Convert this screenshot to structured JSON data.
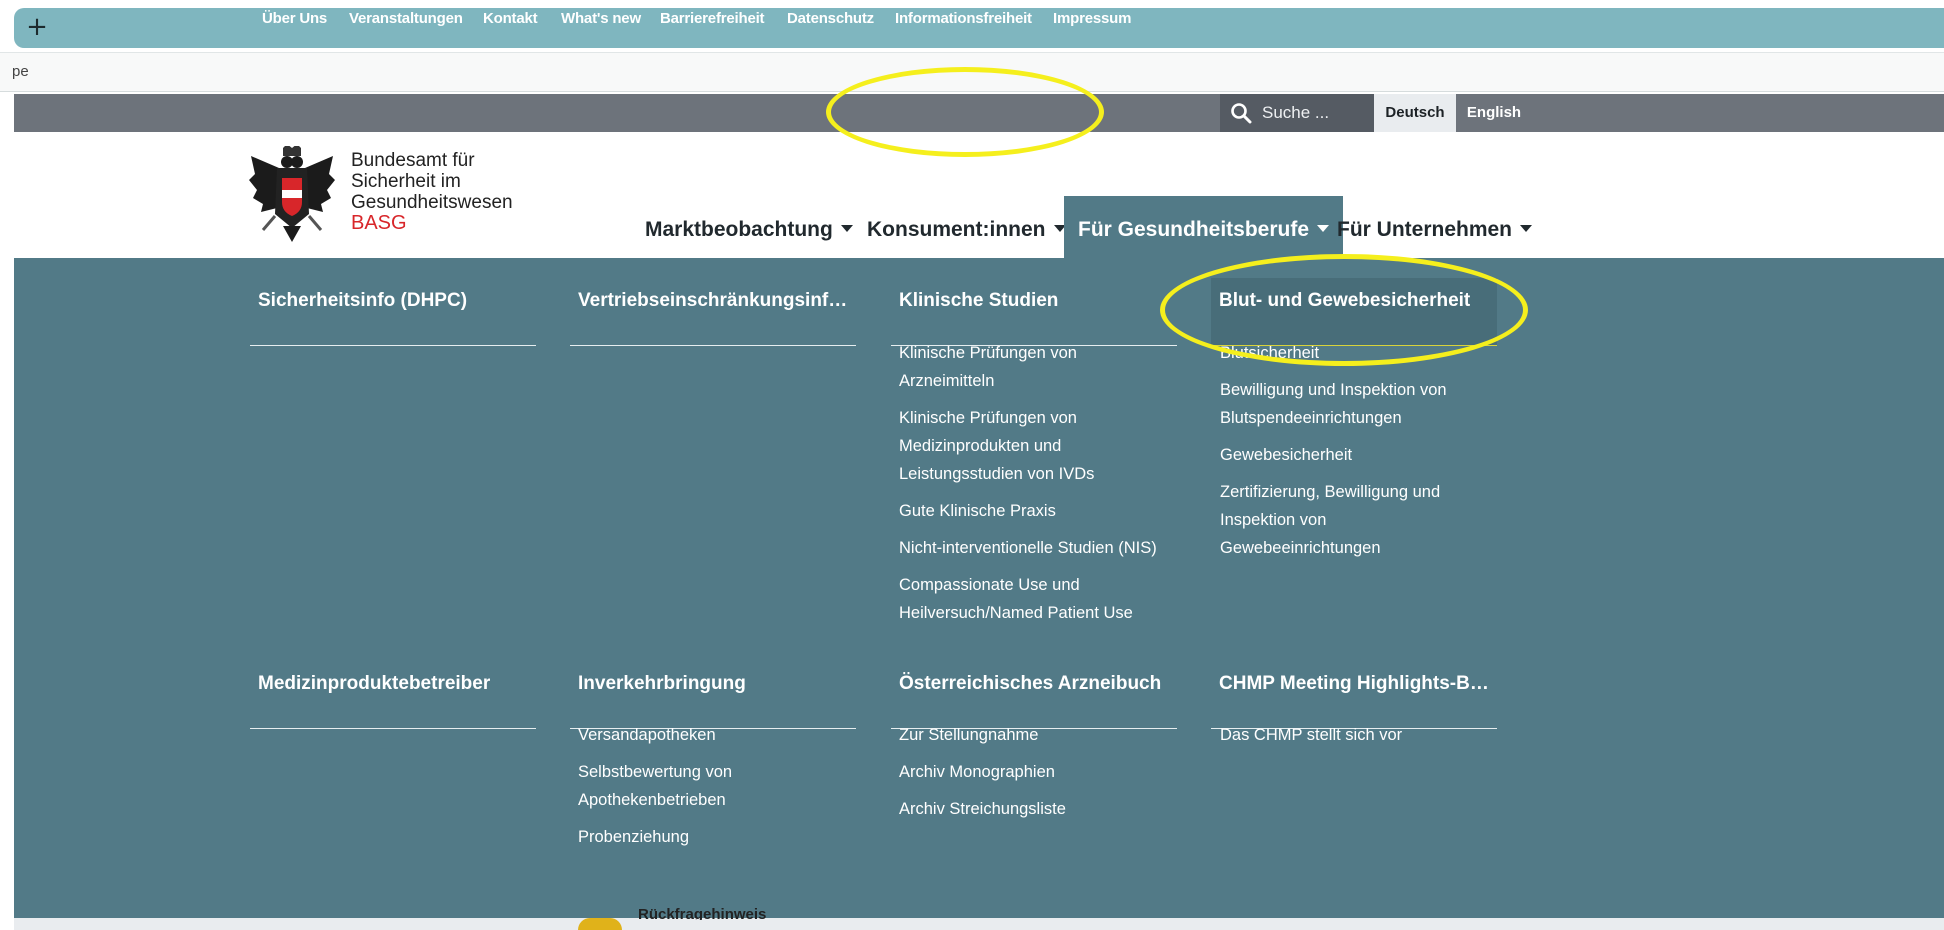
{
  "browser": {
    "new_tab_label": "+",
    "address_fragment": "pe"
  },
  "topbar": {
    "links": [
      "Über Uns",
      "Veranstaltungen",
      "Kontakt",
      "What's new",
      "Barrierefreiheit",
      "Datenschutz",
      "Informationsfreiheit",
      "Impressum"
    ],
    "search_placeholder": "Suche ...",
    "languages": [
      "Deutsch",
      "English"
    ],
    "active_language": "Deutsch"
  },
  "brand": {
    "line1": "Bundesamt für",
    "line2": "Sicherheit im",
    "line3": "Gesundheitswesen",
    "abbr": "BASG"
  },
  "mainnav": {
    "items": [
      "Marktbeobachtung",
      "Konsument:innen",
      "Für Gesundheitsberufe",
      "Für Unternehmen"
    ],
    "active": "Für Gesundheitsberufe"
  },
  "megamenu": {
    "row1": [
      {
        "title": "Sicherheitsinfo (DHPC)",
        "items": []
      },
      {
        "title": "Vertriebseinschränkungsinfo (...",
        "items": []
      },
      {
        "title": "Klinische Studien",
        "items": [
          "Klinische Prüfungen von Arzneimitteln",
          "Klinische Prüfungen von Medizinprodukten und Leistungsstudien von IVDs",
          "Gute Klinische Praxis",
          "Nicht-interventionelle Studien (NIS)",
          "Compassionate Use und Heilversuch/Named Patient Use"
        ]
      },
      {
        "title": "Blut- und Gewebesicherheit",
        "items": [
          "Blutsicherheit",
          "Bewilligung und Inspektion von Blutspendeeinrichtungen",
          "Gewebesicherheit",
          "Zertifizierung, Bewilligung und Inspektion von Gewebeeinrichtungen"
        ]
      }
    ],
    "row2": [
      {
        "title": "Medizinproduktebetreiber",
        "items": []
      },
      {
        "title": "Inverkehrbringung",
        "items": [
          "Versandapotheken",
          "Selbstbewertung von Apothekenbetrieben",
          "Probenziehung"
        ]
      },
      {
        "title": "Österreichisches Arzneibuch",
        "items": [
          "Zur Stellungnahme",
          "Archiv Monographien",
          "Archiv Streichungsliste"
        ]
      },
      {
        "title": "CHMP Meeting Highlights-BA...",
        "items": [
          "Das CHMP stellt sich vor"
        ]
      }
    ]
  },
  "footer_peek": {
    "text": "Rückfragehinweis"
  },
  "colors": {
    "topbar": "#6d737b",
    "megamenu": "#527a87",
    "annotation": "#f5ef1d",
    "brand_red": "#d8262a"
  }
}
